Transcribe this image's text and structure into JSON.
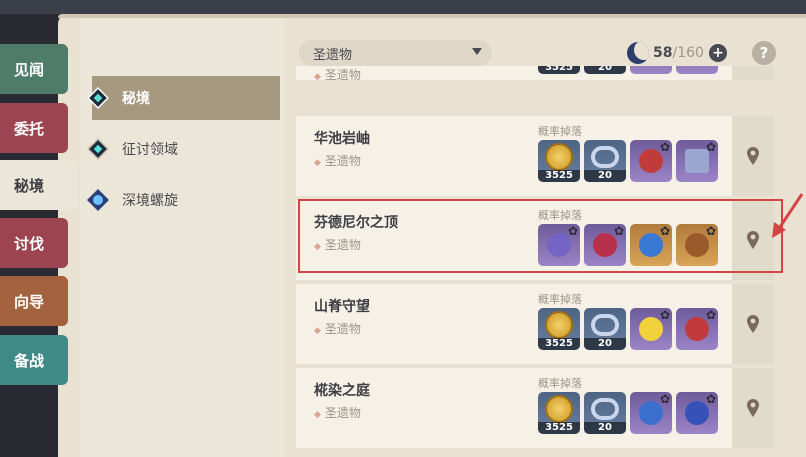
{
  "tabs": [
    {
      "label": "见闻",
      "color": "#4f7b6a"
    },
    {
      "label": "委托",
      "color": "#9c4450"
    },
    {
      "label": "秘境",
      "color": "#ece6d8"
    },
    {
      "label": "讨伐",
      "color": "#9c4450"
    },
    {
      "label": "向导",
      "color": "#a5623e"
    },
    {
      "label": "备战",
      "color": "#3f8a86"
    }
  ],
  "nav": [
    {
      "label": "秘境",
      "icon": "domain-gem-icon"
    },
    {
      "label": "征讨领域",
      "icon": "trounce-gem-icon"
    },
    {
      "label": "深境螺旋",
      "icon": "abyss-icon"
    }
  ],
  "filter": {
    "selected": "圣遗物"
  },
  "resin": {
    "current": "58",
    "max": "/160",
    "plus": "+"
  },
  "help_label": "?",
  "partial_card": {
    "sub": "圣遗物"
  },
  "cards": [
    {
      "name": "华池岩岫",
      "sub": "圣遗物",
      "drops_label": "概率掉落",
      "items": [
        {
          "icon": "mora-coin-icon",
          "qty": "3525"
        },
        {
          "icon": "exp-ring-icon",
          "qty": "20"
        },
        {
          "icon": "artifact-flower-red-icon"
        },
        {
          "icon": "artifact-card-icon"
        }
      ]
    },
    {
      "name": "芬德尼尔之顶",
      "sub": "圣遗物",
      "drops_label": "概率掉落",
      "items": [
        {
          "icon": "artifact-bell-purple-icon"
        },
        {
          "icon": "artifact-flower-red-icon"
        },
        {
          "icon": "artifact-snowflake-icon"
        },
        {
          "icon": "artifact-lion-icon"
        }
      ]
    },
    {
      "name": "山脊守望",
      "sub": "圣遗物",
      "drops_label": "概率掉落",
      "items": [
        {
          "icon": "mora-coin-icon",
          "qty": "3525"
        },
        {
          "icon": "exp-ring-icon",
          "qty": "20"
        },
        {
          "icon": "artifact-flower-yellow-icon"
        },
        {
          "icon": "artifact-flower-red-icon"
        }
      ]
    },
    {
      "name": "椛染之庭",
      "sub": "圣遗物",
      "drops_label": "概率掉落",
      "items": [
        {
          "icon": "mora-coin-icon",
          "qty": "3525"
        },
        {
          "icon": "exp-ring-icon",
          "qty": "20"
        },
        {
          "icon": "artifact-blue-icon"
        },
        {
          "icon": "artifact-blue-feather-icon"
        }
      ]
    }
  ],
  "colors": {
    "highlight": "#d64545",
    "accent": "#a79880"
  }
}
